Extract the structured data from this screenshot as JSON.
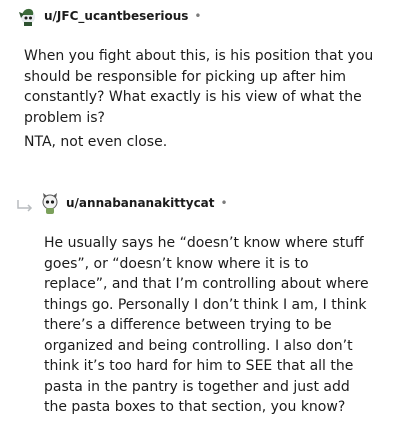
{
  "comment1": {
    "username": "u/JFC_ucantbeserious",
    "separator": "•",
    "paragraph1": "When you fight about this, is his position that you should be responsible for picking up after him constantly? What exactly is his view of what the problem is?",
    "paragraph2": "NTA, not even close.",
    "avatar_icon": "snoo-avatar-icon"
  },
  "comment2": {
    "username": "u/annabananakittycat",
    "separator": "•",
    "paragraph1": "He usually says he “doesn’t know where stuff goes”, or “doesn’t know where it is to replace”, and that I’m controlling about where things go. Personally I don’t think I am, I think there’s a difference between trying to be organized and being controlling. I also don’t think it’s too hard for him to SEE that all the pasta in the pantry is together and just add the pasta boxes to that section, you know?",
    "avatar_icon": "snoo-avatar-icon",
    "reply_icon": "reply-arrow-icon"
  }
}
